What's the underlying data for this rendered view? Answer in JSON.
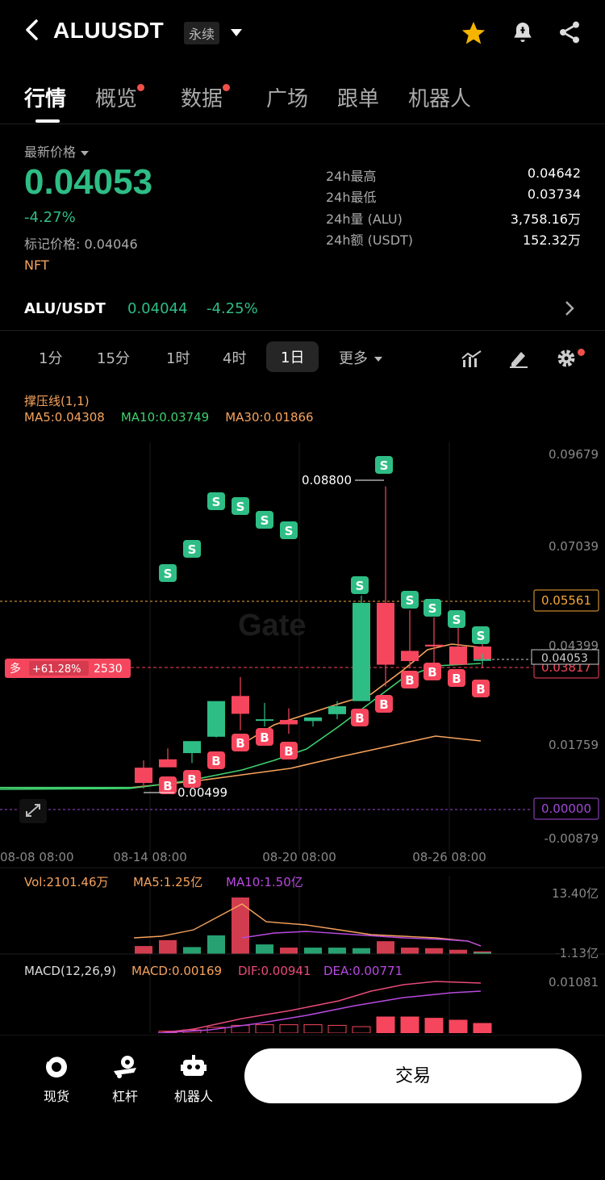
{
  "header": {
    "back_glyph": "<",
    "symbol": "ALUUSDT",
    "contract_type": "永续",
    "icons": [
      "star-icon",
      "bell-icon",
      "share-icon"
    ],
    "star_color": "#f4b400"
  },
  "tabs": [
    {
      "label": "行情",
      "active": true,
      "dot": false
    },
    {
      "label": "概览",
      "active": false,
      "dot": true
    },
    {
      "label": "数据",
      "active": false,
      "dot": true
    },
    {
      "label": "广场",
      "active": false,
      "dot": false
    },
    {
      "label": "跟单",
      "active": false,
      "dot": false
    },
    {
      "label": "机器人",
      "active": false,
      "dot": false
    }
  ],
  "price": {
    "label": "最新价格",
    "last": "0.04053",
    "change_pct": "-4.27%",
    "mark_label": "标记价格: 0.04046",
    "tag": "NFT",
    "stats": [
      {
        "label": "24h最高",
        "value": "0.04642"
      },
      {
        "label": "24h最低",
        "value": "0.03734"
      },
      {
        "label": "24h量 (ALU)",
        "value": "3,758.16万"
      },
      {
        "label": "24h额 (USDT)",
        "value": "152.32万"
      }
    ],
    "up_color": "#2ebd85",
    "down_color": "#f6465d"
  },
  "spot_pair": {
    "name": "ALU/USDT",
    "price": "0.04044",
    "change": "-4.25%"
  },
  "intervals": {
    "items": [
      "1分",
      "15分",
      "1时",
      "4时",
      "1日"
    ],
    "active": "1日",
    "more_label": "更多"
  },
  "indicators": {
    "title": "撑压线(1,1)",
    "ma5": "MA5:0.04308",
    "ma10": "MA10:0.03749",
    "ma30": "MA30:0.01866",
    "vol_label": "Vol:2101.46万",
    "vol_ma5": "MA5:1.25亿",
    "vol_ma10": "MA10:1.50亿",
    "vol_top": "13.40亿",
    "vol_bottom": "-1.13亿",
    "macd_title": "MACD(12,26,9)",
    "macd_val": "MACD:0.00169",
    "dif": "DIF:0.00941",
    "dea": "DEA:0.00771",
    "macd_top": "0.01081"
  },
  "chart_data": {
    "type": "candlestick",
    "y_axis_labels": [
      "0.09679",
      "0.07039",
      "0.04399",
      "0.01759",
      "-0.00879"
    ],
    "x_axis_labels": [
      "08-08 08:00",
      "08-14 08:00",
      "08-20 08:00",
      "08-26 08:00"
    ],
    "ylim": [
      -0.00879,
      0.09679
    ],
    "high_annotation": "0.08800",
    "low_annotation": "0.00499",
    "resistance_label": "0.05561",
    "support_label": "0.03817",
    "current_label": "0.04053",
    "zero_label": "0.00000",
    "position": {
      "side": "多",
      "pnl": "+61.28%",
      "size": "2530"
    },
    "candles": [
      {
        "date": "08-08",
        "o": 0.0052,
        "h": 0.0054,
        "l": 0.005,
        "c": 0.0052
      },
      {
        "date": "08-14",
        "o": 0.0107,
        "h": 0.0127,
        "l": 0.005,
        "c": 0.0065
      },
      {
        "date": "08-15",
        "o": 0.013,
        "h": 0.016,
        "l": 0.011,
        "c": 0.0108
      },
      {
        "date": "08-16",
        "o": 0.0147,
        "h": 0.017,
        "l": 0.012,
        "c": 0.018
      },
      {
        "date": "08-17",
        "o": 0.0192,
        "h": 0.0265,
        "l": 0.019,
        "c": 0.029
      },
      {
        "date": "08-18",
        "o": 0.0304,
        "h": 0.0356,
        "l": 0.021,
        "c": 0.0255
      },
      {
        "date": "08-19",
        "o": 0.024,
        "h": 0.0285,
        "l": 0.022,
        "c": 0.024
      },
      {
        "date": "08-20",
        "o": 0.0238,
        "h": 0.027,
        "l": 0.02,
        "c": 0.0226
      },
      {
        "date": "08-21",
        "o": 0.0235,
        "h": 0.0242,
        "l": 0.022,
        "c": 0.0245
      },
      {
        "date": "08-22",
        "o": 0.0254,
        "h": 0.029,
        "l": 0.024,
        "c": 0.0276
      },
      {
        "date": "08-23",
        "o": 0.029,
        "h": 0.058,
        "l": 0.029,
        "c": 0.056
      },
      {
        "date": "08-24",
        "o": 0.056,
        "h": 0.088,
        "l": 0.033,
        "c": 0.039
      },
      {
        "date": "08-25",
        "o": 0.0428,
        "h": 0.054,
        "l": 0.038,
        "c": 0.04
      },
      {
        "date": "08-26",
        "o": 0.0445,
        "h": 0.052,
        "l": 0.039,
        "c": 0.044
      },
      {
        "date": "08-27",
        "o": 0.044,
        "h": 0.051,
        "l": 0.04,
        "c": 0.039
      },
      {
        "date": "08-28",
        "o": 0.044,
        "h": 0.048,
        "l": 0.038,
        "c": 0.0405
      },
      {
        "date": "08-29",
        "o": 0.0405,
        "h": 0.042,
        "l": 0.039,
        "c": 0.0405
      }
    ],
    "volume": [
      0.15,
      0.26,
      0.13,
      0.35,
      1.06,
      0.18,
      0.12,
      0.12,
      0.12,
      0.11,
      0.24,
      0.12,
      0.11,
      0.08,
      0.05,
      0.03
    ],
    "macd_hist": [
      0.0003,
      0.0005,
      0.0009,
      0.0012,
      0.0013,
      0.0013,
      0.0013,
      0.0012,
      0.001,
      0.0025,
      0.0025,
      0.0023,
      0.002,
      0.0015,
      0.001
    ]
  },
  "bottom_bar": {
    "items": [
      {
        "label": "现货",
        "icon": "spot-icon"
      },
      {
        "label": "杠杆",
        "icon": "leverage-icon"
      },
      {
        "label": "机器人",
        "icon": "robot-icon"
      }
    ],
    "trade_label": "交易"
  }
}
